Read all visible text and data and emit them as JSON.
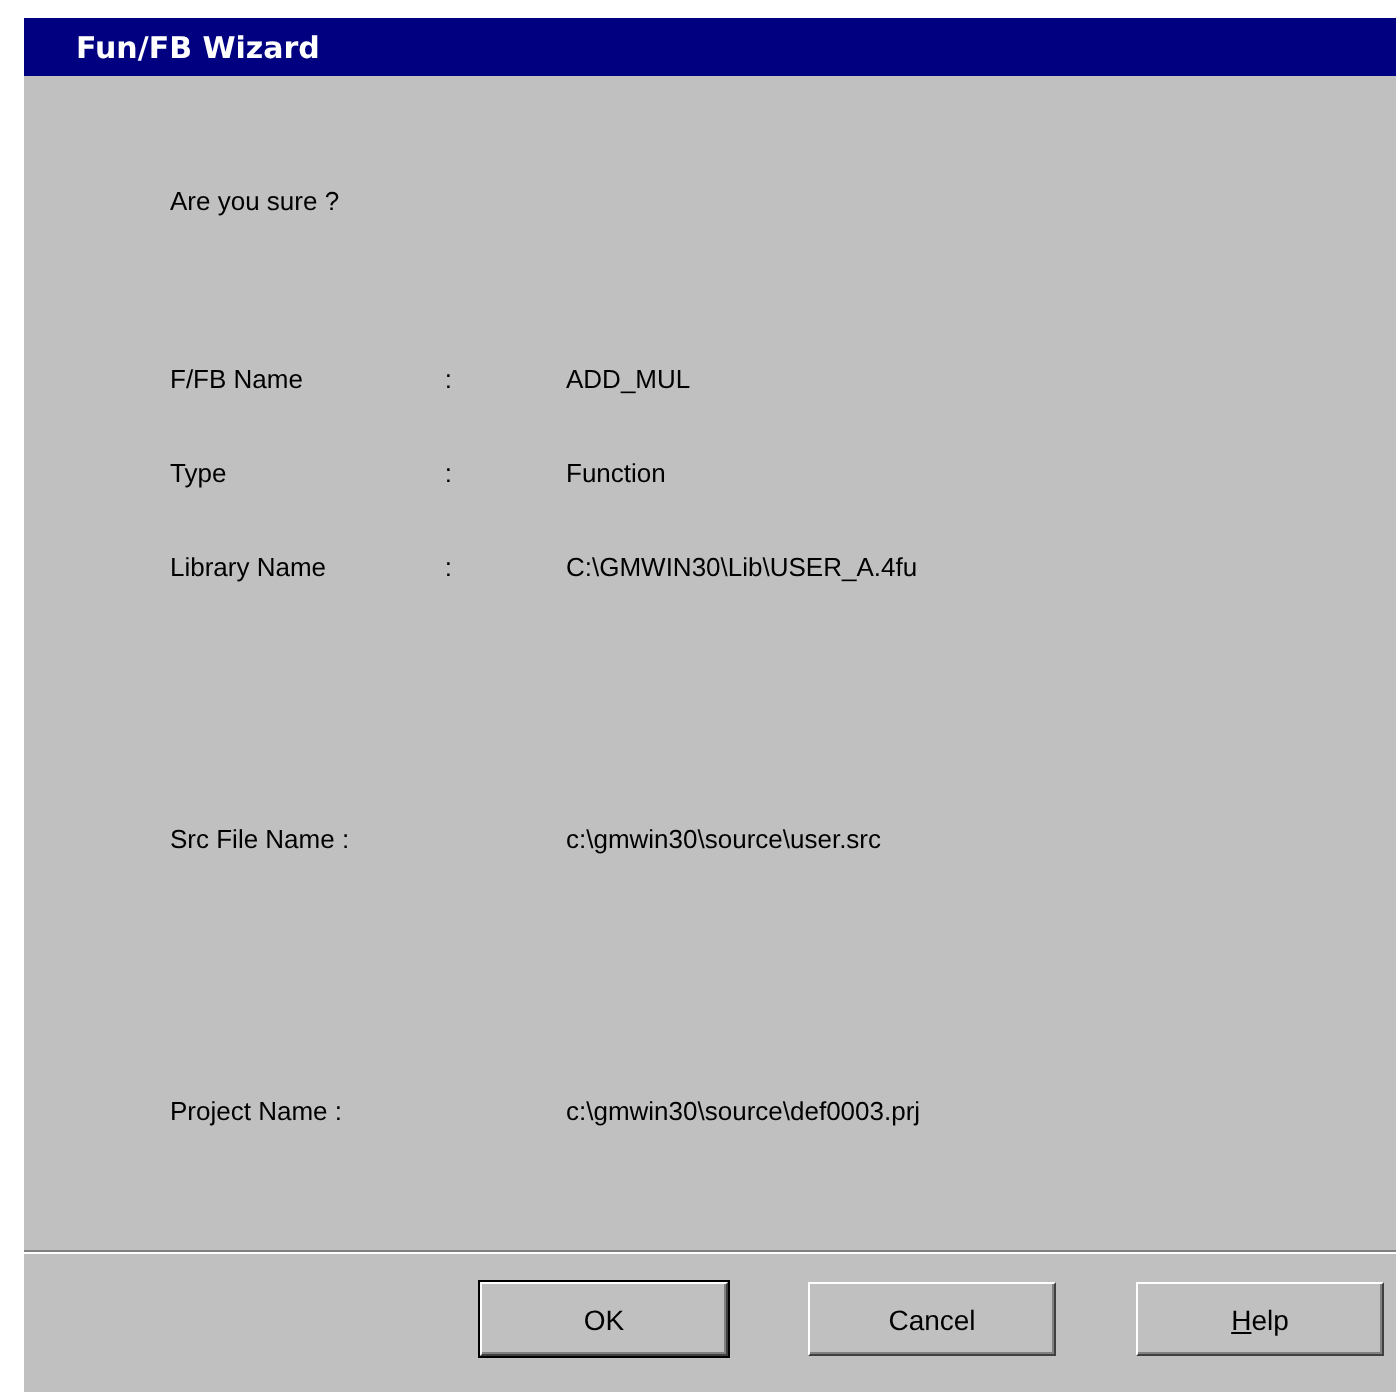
{
  "window": {
    "title": "Fun/FB Wizard"
  },
  "prompt": "Are you sure ?",
  "field_groups": [
    [
      {
        "label": "F/FB Name",
        "colon": ":",
        "value": "ADD_MUL"
      },
      {
        "label": "Type",
        "colon": ":",
        "value": "Function"
      },
      {
        "label": "Library Name",
        "colon": ":",
        "value": "C:\\GMWIN30\\Lib\\USER_A.4fu"
      }
    ],
    [
      {
        "label": "Src File Name :",
        "value": "c:\\gmwin30\\source\\user.src"
      }
    ],
    [
      {
        "label": "Project Name :",
        "value": "c:\\gmwin30\\source\\def0003.prj"
      }
    ]
  ],
  "buttons": [
    {
      "label": "OK",
      "default": true,
      "underline_first": false
    },
    {
      "label": "Cancel",
      "default": false,
      "underline_first": false
    },
    {
      "label": "Help",
      "default": false,
      "underline_first": true
    }
  ]
}
